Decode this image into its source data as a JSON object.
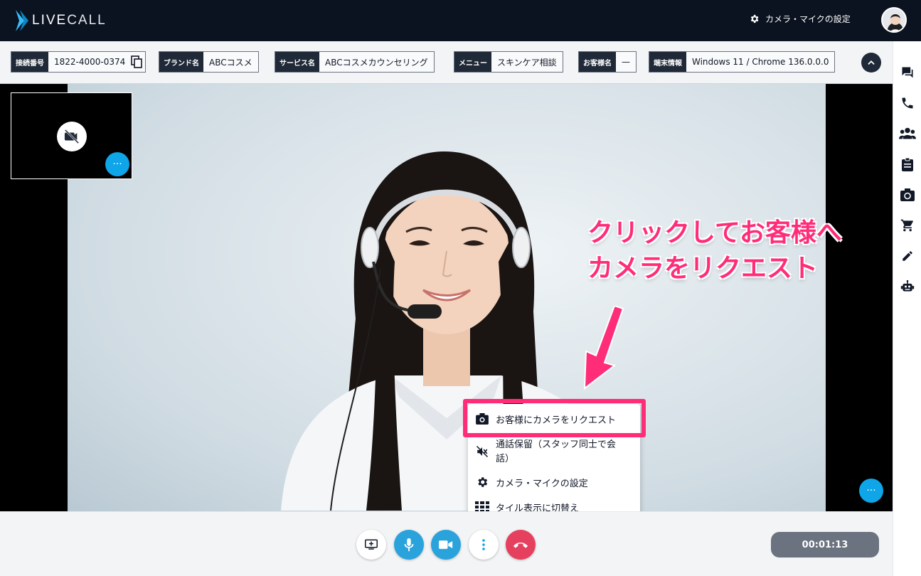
{
  "header": {
    "logo_text_bold": "LIVE",
    "logo_text_thin": "CALL",
    "settings_label": "カメラ・マイクの設定"
  },
  "info": [
    {
      "key": "接続番号",
      "value": "1822-4000-0374"
    },
    {
      "key": "ブランド名",
      "value": "ABCコスメ"
    },
    {
      "key": "サービス名",
      "value": "ABCコスメカウンセリング"
    },
    {
      "key": "メニュー",
      "value": "スキンケア相談"
    },
    {
      "key": "お客様名",
      "value": "—"
    },
    {
      "key": "端末情報",
      "value": "Windows 11 / Chrome 136.0.0.0"
    }
  ],
  "annotation": {
    "line1": "クリックしてお客様へ",
    "line2": "カメラをリクエスト"
  },
  "menu": {
    "items": [
      {
        "label": "お客様にカメラをリクエスト",
        "icon": "camera-icon"
      },
      {
        "label_line1": "通話保留（スタッフ同士で会",
        "label_line2": "話）",
        "icon": "mute-icon"
      },
      {
        "label": "カメラ・マイクの設定",
        "icon": "gear-icon"
      },
      {
        "label": "タイル表示に切替え",
        "icon": "grid-icon"
      }
    ]
  },
  "controls": {
    "timer": "00:01:13",
    "more_label": "···"
  },
  "sidebar": [
    "chat-icon",
    "phone-icon",
    "group-icon",
    "clipboard-icon",
    "camera-switch-icon",
    "cart-icon",
    "pencil-icon",
    "robot-icon"
  ],
  "colors": {
    "header_bg": "#0b1220",
    "accent": "#0ea5e9",
    "highlight": "#ff2d78",
    "hangup": "#e11d48"
  }
}
